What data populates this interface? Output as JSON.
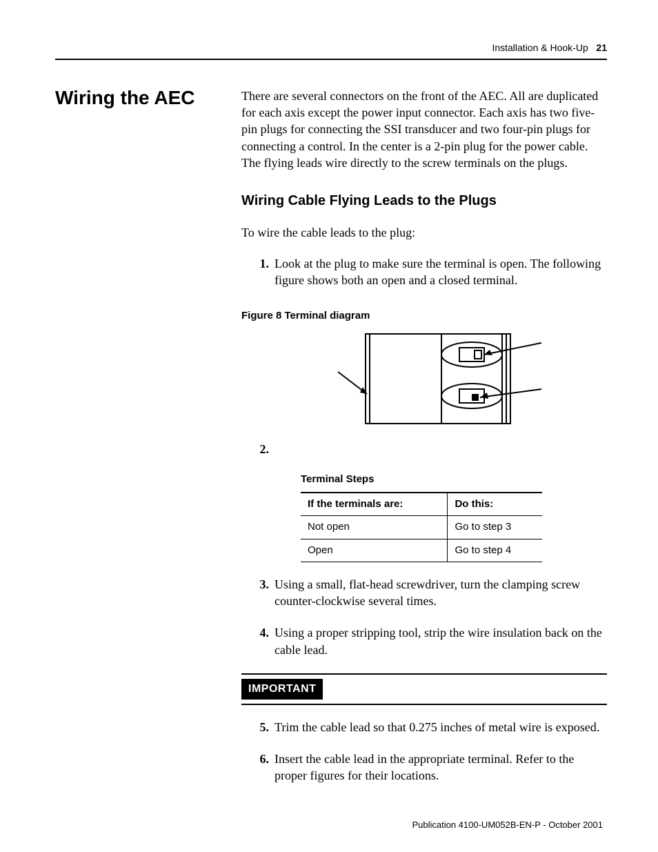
{
  "header": {
    "section": "Installation & Hook-Up",
    "page_number": "21"
  },
  "side_heading": "Wiring the AEC",
  "intro_paragraph": "There are several connectors on the front of the AEC. All are duplicated for each axis except the power input connector. Each axis has two five-pin plugs for connecting the SSI transducer and two four-pin plugs for connecting a control. In the center is a 2-pin plug for the power cable. The flying leads wire directly to the screw terminals on the plugs.",
  "subheading": "Wiring Cable Flying Leads to the Plugs",
  "lead_in": "To wire the cable leads to the plug:",
  "steps": {
    "s1": {
      "num": "1.",
      "text": "Look at the plug to make sure the terminal is open. The following figure shows both an open and a closed terminal."
    },
    "s2": {
      "num": "2."
    },
    "s3": {
      "num": "3.",
      "text": "Using a small, flat-head screwdriver, turn the clamping screw counter-clockwise several times."
    },
    "s4": {
      "num": "4.",
      "text": "Using a proper stripping tool, strip the wire insulation back on the cable lead."
    },
    "s5": {
      "num": "5.",
      "text": "Trim the cable lead so that 0.275 inches of metal wire is exposed."
    },
    "s6": {
      "num": "6.",
      "text": "Insert the cable lead in the appropriate terminal. Refer to the proper figures for their locations."
    }
  },
  "figure": {
    "caption": "Figure 8 Terminal diagram"
  },
  "table": {
    "title": "Terminal Steps",
    "headers": {
      "c1": "If the terminals are:",
      "c2": "Do this:"
    },
    "rows": [
      {
        "c1": "Not open",
        "c2": "Go to step 3"
      },
      {
        "c1": "Open",
        "c2": "Go to step 4"
      }
    ]
  },
  "important_label": "IMPORTANT",
  "footer": "Publication 4100-UM052B-EN-P - October 2001"
}
